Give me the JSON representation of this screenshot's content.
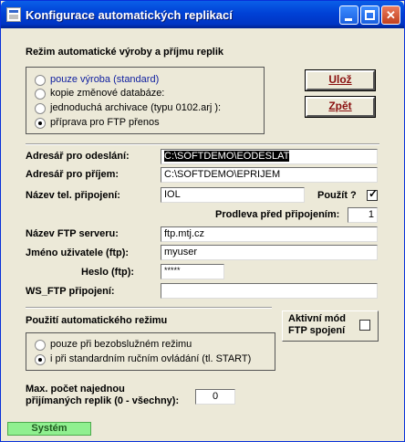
{
  "window": {
    "title": "Konfigurace automatických replikací",
    "min_symbol": "",
    "max_symbol": "",
    "close_symbol": "✕"
  },
  "rezim": {
    "heading": "Režim automatické výroby a příjmu replik",
    "options": [
      {
        "label": "pouze výroba (standard)",
        "checked": false,
        "highlighted": true
      },
      {
        "label": "kopie změnové databáze:",
        "checked": false
      },
      {
        "label": "jednoduchá archivace (typu 0102.arj ):",
        "checked": false
      },
      {
        "label": "příprava pro FTP přenos",
        "checked": true
      }
    ]
  },
  "buttons": {
    "uloz": "Ulož",
    "zpet": "Zpět"
  },
  "form": {
    "adresar_odeslani_label": "Adresář pro odeslání:",
    "adresar_odeslani_value": "C:\\SOFTDEMO\\EODESLAT",
    "adresar_prijem_label": "Adresář pro příjem:",
    "adresar_prijem_value": "C:\\SOFTDEMO\\EPRIJEM",
    "tel_pripojeni_label": "Název tel. připojení:",
    "tel_pripojeni_value": "IOL",
    "pouzit_label": "Použít ?",
    "pouzit_checked": true,
    "prodleva_label": "Prodleva před připojením:",
    "prodleva_value": "1",
    "ftp_server_label": "Název FTP serveru:",
    "ftp_server_value": "ftp.mtj.cz",
    "jmeno_label": "Jméno uživatele (ftp):",
    "jmeno_value": "myuser",
    "heslo_label": "Heslo (ftp):",
    "heslo_value": "*****",
    "ws_ftp_label": "WS_FTP připojení:",
    "ws_ftp_value": ""
  },
  "automat": {
    "heading": "Použití automatického režimu",
    "options": [
      {
        "label": "pouze při bezobslužném režimu",
        "checked": false
      },
      {
        "label": "i při standardním ručním ovládání (tl. START)",
        "checked": true
      }
    ],
    "aktivni_label_line1": "Aktivní mód",
    "aktivni_label_line2": "FTP spojení",
    "aktivni_checked": false
  },
  "max_pocet": {
    "label_line1": "Max. počet najednou",
    "label_line2": "přijímaných replik (0 - všechny):",
    "value": "0"
  },
  "status": {
    "tab_label": "Systém"
  },
  "colors": {
    "title_bar": "#0041d6",
    "button_text": "#8a1010",
    "status_tab": "#90f090"
  }
}
